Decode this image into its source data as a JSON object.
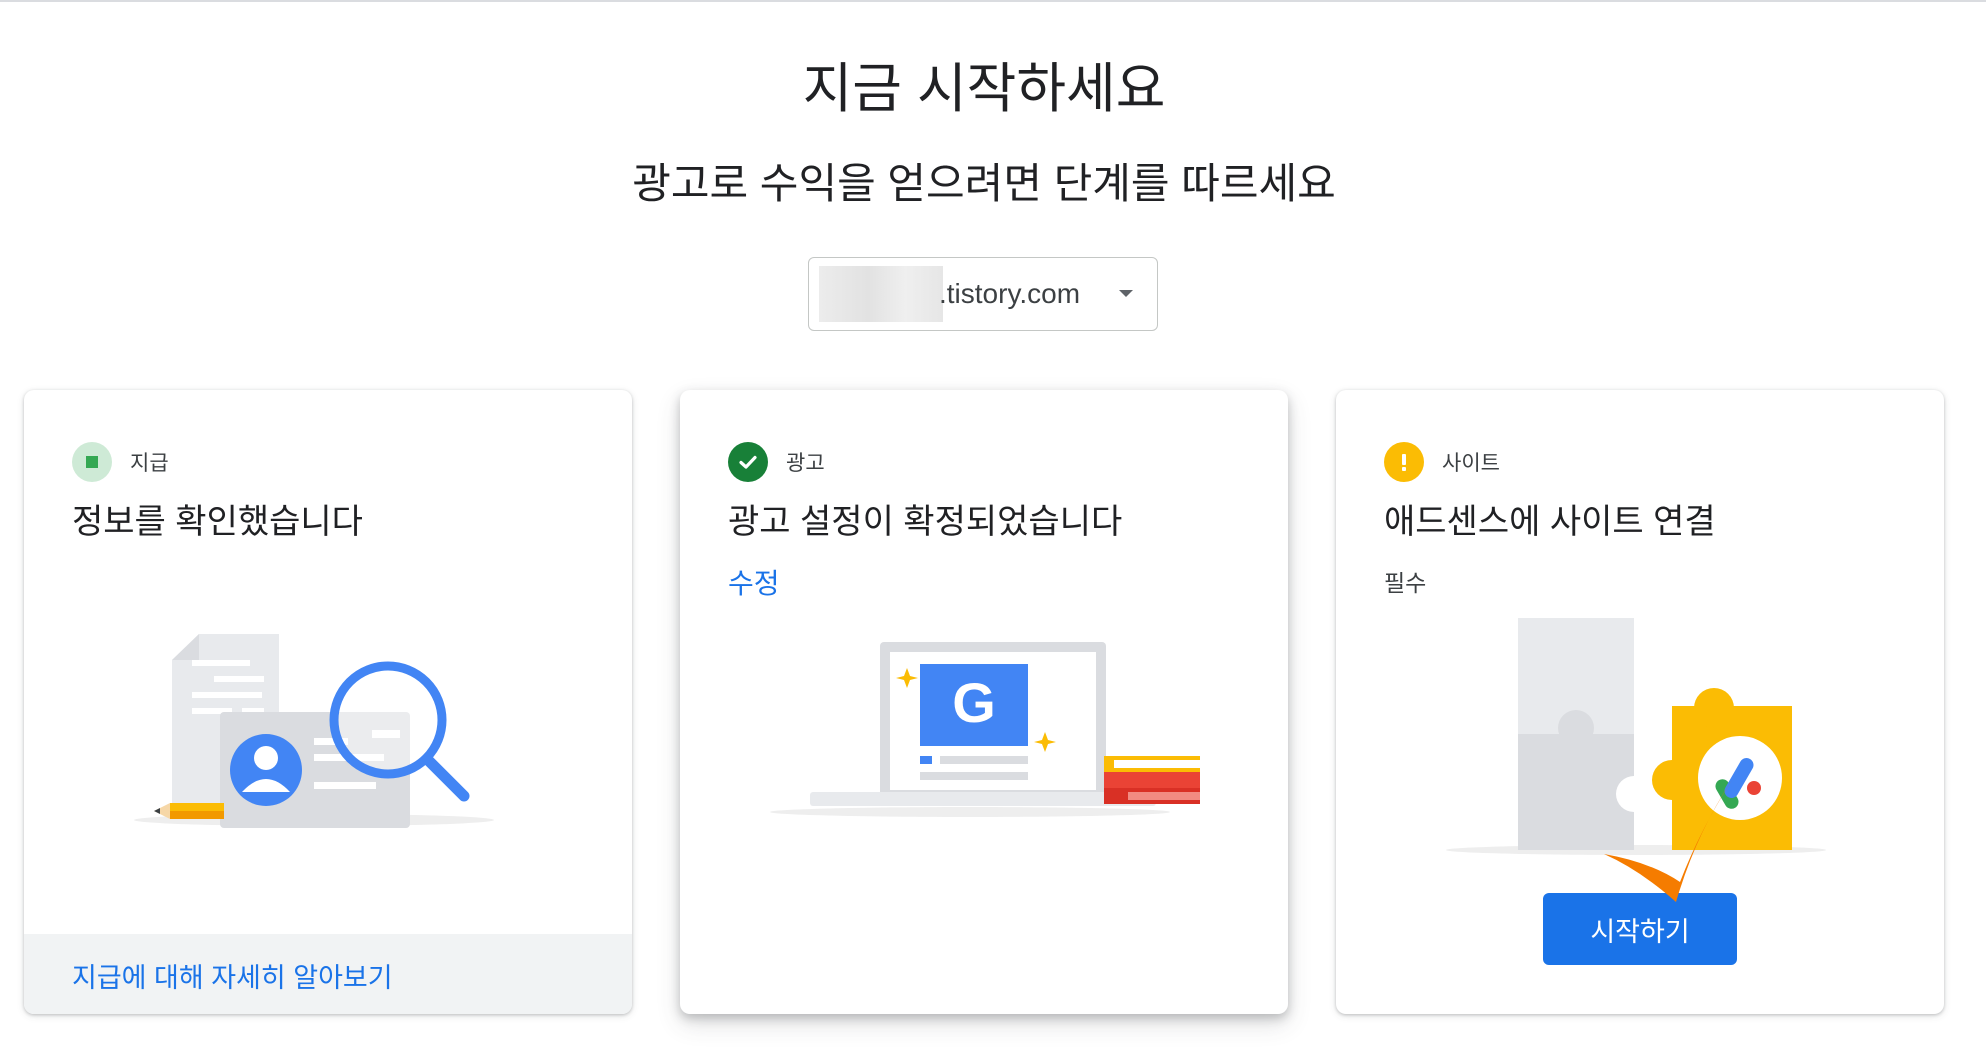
{
  "header": {
    "title": "지금 시작하세요",
    "subtitle": "광고로 수익을 얻으려면 단계를 따르세요"
  },
  "site_selector": {
    "domain_visible": ".tistory.com",
    "icon": "dropdown-arrow-icon"
  },
  "cards": [
    {
      "status_label": "지급",
      "status_icon": "square-pending-icon",
      "status_color": "#34a853",
      "title": "정보를 확인했습니다",
      "footer_link": "지급에 대해 자세히 알아보기"
    },
    {
      "status_label": "광고",
      "status_icon": "check-circle-icon",
      "status_color": "#188038",
      "title": "광고 설정이 확정되었습니다",
      "link": "수정"
    },
    {
      "status_label": "사이트",
      "status_icon": "warning-exclamation-icon",
      "status_color": "#fbbc04",
      "title": "애드센스에 사이트 연결",
      "note": "필수",
      "button_label": "시작하기"
    }
  ],
  "colors": {
    "accent": "#1a73e8",
    "annotation_check": "#f57c00"
  }
}
